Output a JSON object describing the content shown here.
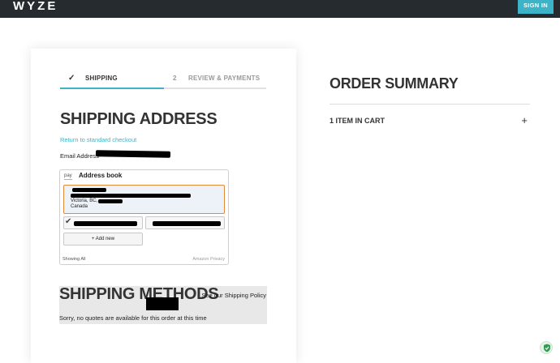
{
  "header": {
    "logo_text": "WYZE",
    "signin_label": "SIGN IN",
    "accent_color": "#3db3c7"
  },
  "checkout": {
    "steps": [
      {
        "number": "",
        "label": "SHIPPING",
        "icon": "check-icon",
        "active": true
      },
      {
        "number": "2",
        "label": "REVIEW & PAYMENTS",
        "active": false
      }
    ],
    "shipping_address_title": "SHIPPING ADDRESS",
    "return_link": "Return to standard checkout",
    "email_label": "Email Address"
  },
  "amazon_widget": {
    "pay_label": "pay",
    "title": "Address book",
    "selected_address": {
      "line1": "Victoria, BC,",
      "line2": "Canada"
    },
    "add_new_label": "+ Add new",
    "showing_label": "Showing All",
    "privacy_label": "Amazon Privacy"
  },
  "shipping_methods": {
    "title": "SHIPPING METHODS",
    "policy_link": "See our Shipping Policy",
    "no_quotes_message": "Sorry, no quotes are available for this order at this time"
  },
  "order_summary": {
    "title": "ORDER SUMMARY",
    "items_label": "1 ITEM IN CART",
    "expand_icon": "plus-icon"
  }
}
